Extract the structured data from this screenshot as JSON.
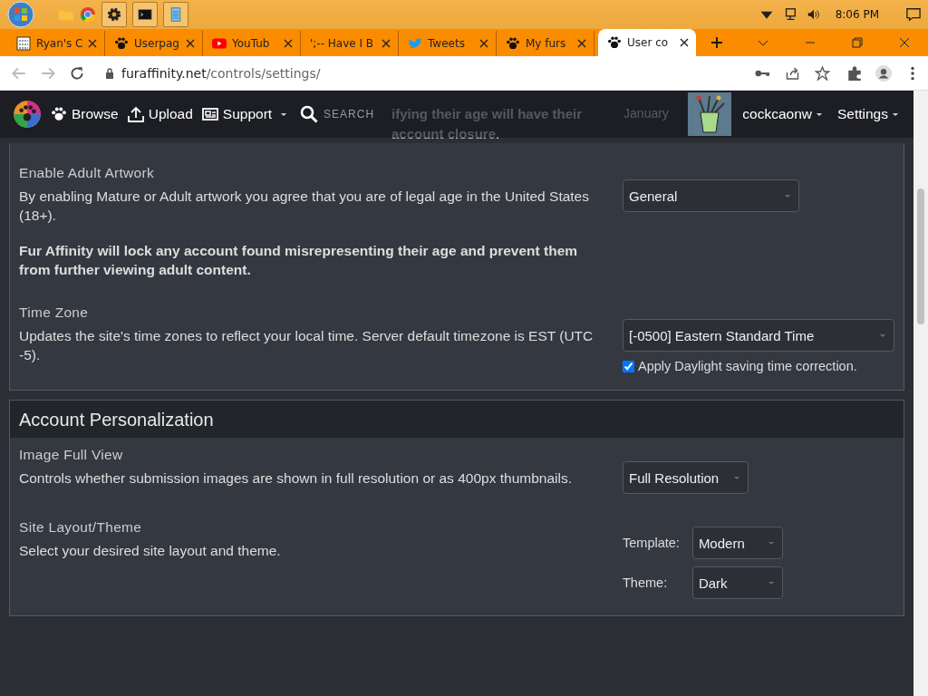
{
  "taskbar": {
    "clock": "8:06 PM"
  },
  "tabs": [
    {
      "title": "Ryan's C",
      "selected": false
    },
    {
      "title": "Userpag",
      "selected": false
    },
    {
      "title": "YouTub",
      "selected": false
    },
    {
      "title": "';-- Have I B",
      "selected": false
    },
    {
      "title": "Tweets",
      "selected": false
    },
    {
      "title": "My furs",
      "selected": false
    },
    {
      "title": "User co",
      "selected": true
    }
  ],
  "address": {
    "host": "furaffinity.net",
    "path": "/controls/settings/"
  },
  "behind": {
    "line_1": "ifying their age will have their",
    "line_2": "account closure.",
    "select": "January"
  },
  "nav": {
    "items": [
      {
        "label": "Browse",
        "dropdown": false
      },
      {
        "label": "Upload",
        "dropdown": false
      },
      {
        "label": "Support",
        "dropdown": true
      }
    ],
    "search": {
      "placeholder": "SEARCH"
    },
    "user": "cockcaonw",
    "settings": "Settings"
  },
  "sections": [
    {
      "settings": [
        {
          "title": "Enable Adult Artwork",
          "description": "By enabling Mature or Adult artwork you agree that you are of legal age in the United States (18+).",
          "note": "Fur Affinity will lock any account found misrepresenting their age and prevent them from further viewing adult content.",
          "kind": "select",
          "value": "General"
        },
        {
          "title": "Time Zone",
          "description": "Updates the site's time zones to reflect your local time. Server default timezone is EST (UTC -5).",
          "kind": "select_check",
          "value": "[-0500] Eastern Standard Time",
          "checkbox": {
            "label": "Apply Daylight saving time correction.",
            "checked": true
          }
        }
      ]
    },
    {
      "header": "Account Personalization",
      "settings": [
        {
          "title": "Image Full View",
          "description": "Controls whether submission images are shown in full resolution or as 400px thumbnails.",
          "kind": "select",
          "value": "Full Resolution"
        },
        {
          "title": "Site Layout/Theme",
          "description": "Select your desired site layout and theme.",
          "kind": "labeled_selects",
          "fields": [
            {
              "label": "Template:",
              "value": "Modern"
            },
            {
              "label": "Theme:",
              "value": "Dark"
            }
          ]
        }
      ]
    }
  ]
}
